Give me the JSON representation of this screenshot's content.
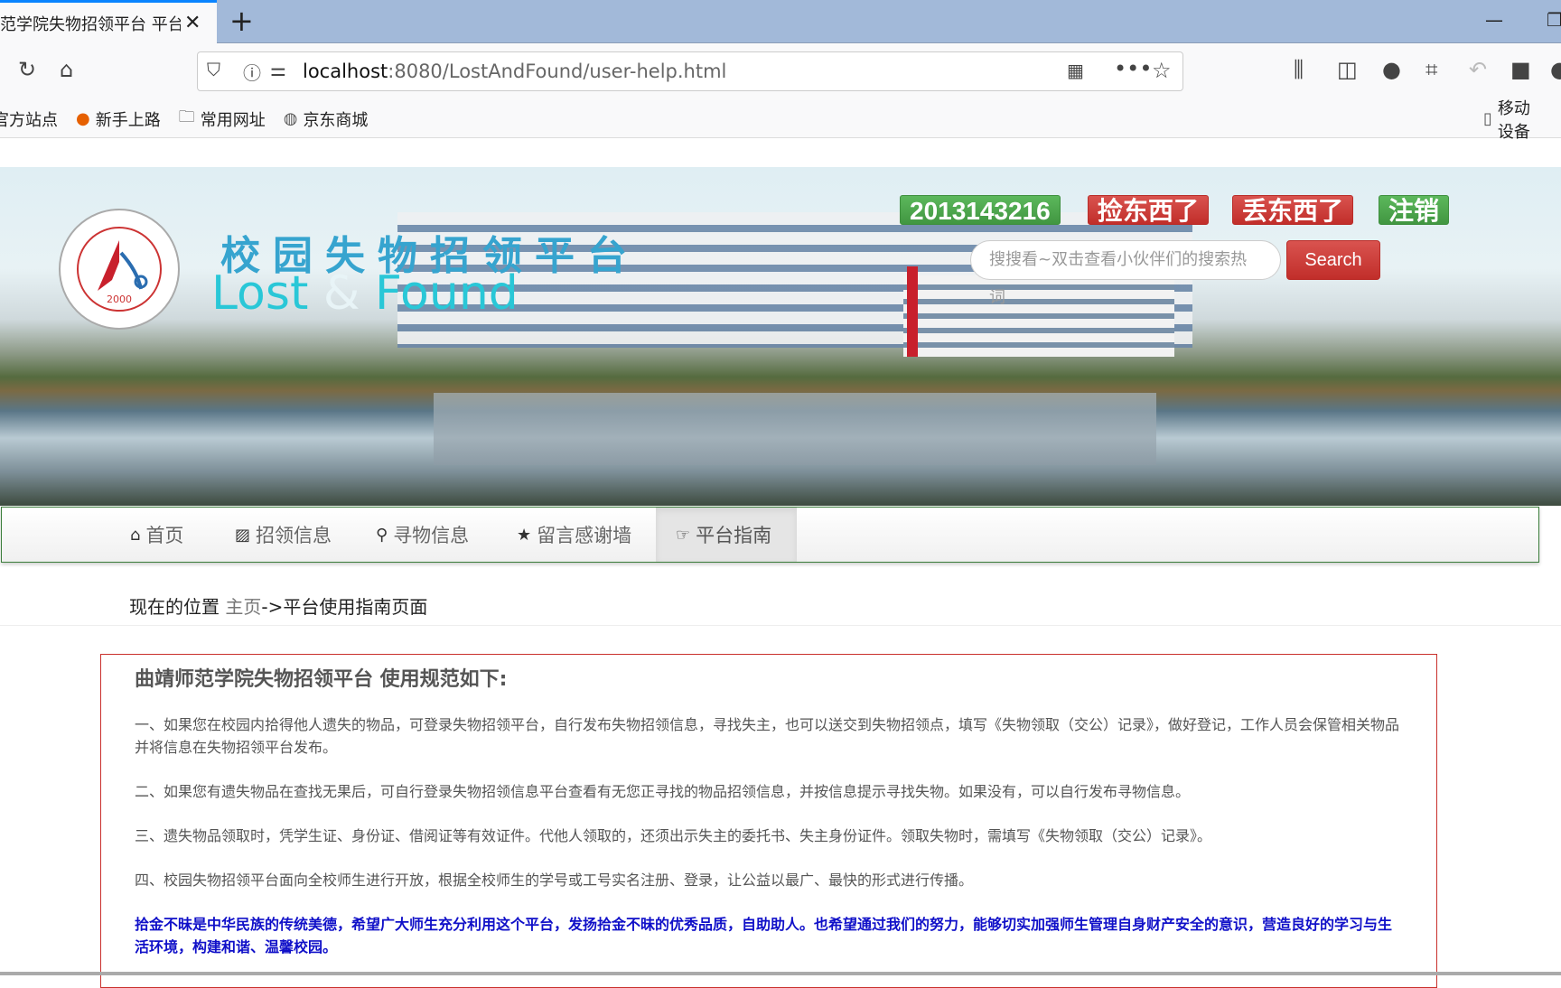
{
  "browser": {
    "tab_title": "范学院失物招领平台 平台",
    "url_host": "localhost",
    "url_rest": ":8080/LostAndFound/user-help.html",
    "bookmarks": [
      "官方站点",
      "新手上路",
      "常用网址",
      "京东商城"
    ],
    "mobile_bookmarks": "移动设备"
  },
  "header": {
    "logo_text": "曲靖师范学院 QUJING NORMAL UNIVERSITY 2000",
    "title_cn": "校园失物招领平台",
    "title_en_1": "Lost",
    "title_en_amp": "&",
    "title_en_2": "Found",
    "user_id": "2013143216",
    "pick_up_label": "捡东西了",
    "lost_label": "丢东西了",
    "logout_label": "注销",
    "search_placeholder": "搜搜看~双击查看小伙伴们的搜索热词",
    "search_button": "Search"
  },
  "nav": {
    "items": [
      {
        "label": "首页",
        "icon": "home-icon"
      },
      {
        "label": "招领信息",
        "icon": "picture-icon"
      },
      {
        "label": "寻物信息",
        "icon": "search-icon"
      },
      {
        "label": "留言感谢墙",
        "icon": "star-icon"
      },
      {
        "label": "平台指南",
        "icon": "hand-right-icon",
        "active": true
      }
    ]
  },
  "breadcrumb": {
    "prefix": "现在的位置 ",
    "home": "主页",
    "current": "->平台使用指南页面"
  },
  "content": {
    "heading": "曲靖师范学院失物招领平台 使用规范如下:",
    "paragraphs": [
      "一、如果您在校园内拾得他人遗失的物品，可登录失物招领平台，自行发布失物招领信息，寻找失主，也可以送交到失物招领点，填写《失物领取（交公）记录》，做好登记，工作人员会保管相关物品并将信息在失物招领平台发布。",
      "二、如果您有遗失物品在查找无果后，可自行登录失物招领信息平台查看有无您正寻找的物品招领信息，并按信息提示寻找失物。如果没有，可以自行发布寻物信息。",
      "三、遗失物品领取时，凭学生证、身份证、借阅证等有效证件。代他人领取的，还须出示失主的委托书、失主身份证件。领取失物时，需填写《失物领取（交公）记录》。",
      "四、校园失物招领平台面向全校师生进行开放，根据全校师生的学号或工号实名注册、登录，让公益以最广、最快的形式进行传播。"
    ],
    "closing": "拾金不昧是中华民族的传统美德，希望广大师生充分利用这个平台，发扬拾金不昧的优秀品质，自助助人。也希望通过我们的努力，能够切实加强师生管理自身财产安全的意识，营造良好的学习与生活环境，构建和谐、温馨校园。"
  },
  "colors": {
    "accent_green": "#5cb85c",
    "accent_red": "#d9534f",
    "closing_text": "#1010c8",
    "nav_border": "#3a7d3a"
  }
}
